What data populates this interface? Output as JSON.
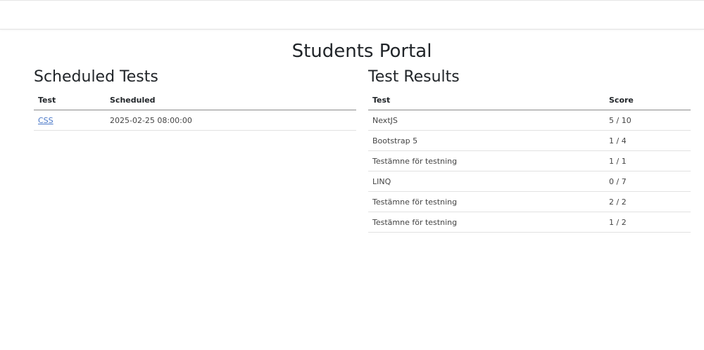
{
  "page": {
    "title": "Students Portal"
  },
  "scheduled": {
    "heading": "Scheduled Tests",
    "columns": [
      "Test",
      "Scheduled"
    ],
    "rows": [
      {
        "test": "CSS",
        "scheduled": "2025-02-25 08:00:00"
      }
    ]
  },
  "results": {
    "heading": "Test Results",
    "columns": [
      "Test",
      "Score"
    ],
    "rows": [
      {
        "test": "NextJS",
        "score": "5 / 10"
      },
      {
        "test": "Bootstrap 5",
        "score": "1 / 4"
      },
      {
        "test": "Testämne för testning",
        "score": "1 / 1"
      },
      {
        "test": "LINQ",
        "score": "0 / 7"
      },
      {
        "test": "Testämne för testning",
        "score": "2 / 2"
      },
      {
        "test": "Testämne för testning",
        "score": "1 / 2"
      }
    ]
  },
  "colors": {
    "link": "#4a78c8",
    "text": "#212529"
  }
}
